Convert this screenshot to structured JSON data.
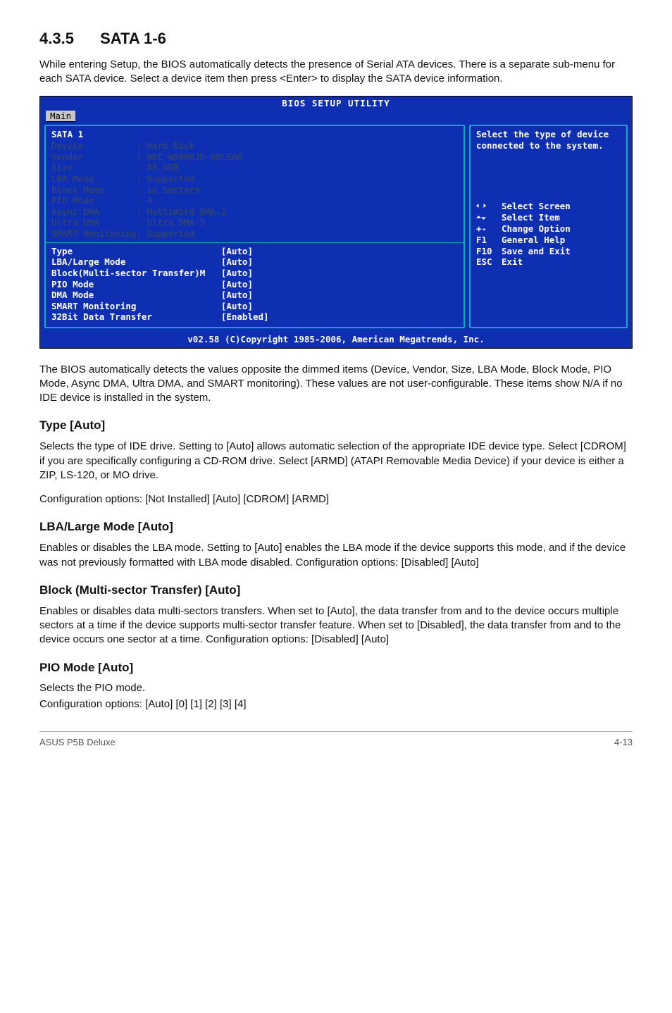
{
  "section": {
    "number": "4.3.5",
    "title": "SATA 1-6",
    "intro": "While entering Setup, the BIOS automatically detects the presence of Serial ATA devices. There is a separate sub-menu for each SATA device. Select a device item then press <Enter> to display the SATA device information."
  },
  "bios": {
    "header": "BIOS SETUP UTILITY",
    "tab": "Main",
    "panel_title": "SATA 1",
    "info": [
      {
        "label": "Device",
        "value": "Hard Disk"
      },
      {
        "label": "Vendor",
        "value": "WDC WD800JD-00LSA0"
      },
      {
        "label": "Size",
        "value": "80.0GB"
      },
      {
        "label": "LBA Mode",
        "value": "Supported"
      },
      {
        "label": "Block Mode",
        "value": "16 Sectors"
      },
      {
        "label": "PIO Mode",
        "value": "4"
      },
      {
        "label": "Async DMA",
        "value": "MultiWord DMA-2"
      },
      {
        "label": "Ultra DMA",
        "value": "Ultra DMA-5"
      },
      {
        "label": "SMART Monitoring",
        "value": "Supported"
      }
    ],
    "settings": [
      {
        "label": "Type",
        "value": "[Auto]"
      },
      {
        "label": "LBA/Large Mode",
        "value": "[Auto]"
      },
      {
        "label": "Block(Multi-sector Transfer)M",
        "value": "[Auto]"
      },
      {
        "label": "PIO Mode",
        "value": "[Auto]"
      },
      {
        "label": "DMA Mode",
        "value": "[Auto]"
      },
      {
        "label": "SMART Monitoring",
        "value": "[Auto]"
      },
      {
        "label": "32Bit Data Transfer",
        "value": "[Enabled]"
      }
    ],
    "help": "Select the type of device connected to the system.",
    "legend": [
      {
        "key": "←→",
        "desc": "Select Screen",
        "icon": "lr"
      },
      {
        "key": "↑↓",
        "desc": "Select Item",
        "icon": "ud"
      },
      {
        "key": "+-",
        "desc": "Change Option"
      },
      {
        "key": "F1",
        "desc": "General Help"
      },
      {
        "key": "F10",
        "desc": "Save and Exit"
      },
      {
        "key": "ESC",
        "desc": "Exit"
      }
    ],
    "footer": "v02.58 (C)Copyright 1985-2006, American Megatrends, Inc."
  },
  "post_bios_para": "The BIOS automatically detects the values opposite the dimmed items (Device, Vendor, Size, LBA Mode, Block Mode, PIO Mode, Async DMA, Ultra DMA, and SMART monitoring). These values are not user-configurable. These items show N/A if no IDE device is installed in the system.",
  "items": {
    "type": {
      "title": "Type [Auto]",
      "body": "Selects the type of IDE drive. Setting to [Auto] allows automatic selection of the appropriate IDE device type. Select [CDROM] if you are specifically configuring a CD-ROM drive. Select [ARMD] (ATAPI Removable Media Device) if your device is either a ZIP, LS-120, or MO drive.",
      "opts": "Configuration options: [Not Installed] [Auto] [CDROM] [ARMD]"
    },
    "lba": {
      "title": "LBA/Large Mode [Auto]",
      "body": "Enables or disables the LBA mode. Setting to [Auto] enables the LBA mode if the device supports this mode, and if the device was not previously formatted with LBA mode disabled. Configuration options: [Disabled] [Auto]"
    },
    "block": {
      "title": "Block (Multi-sector Transfer) [Auto]",
      "body": "Enables or disables data multi-sectors transfers. When set to [Auto], the data transfer from and to the device occurs multiple sectors at a time if the device supports multi-sector transfer feature. When set to [Disabled], the data transfer from and to the device occurs one sector at a time. Configuration options: [Disabled] [Auto]"
    },
    "pio": {
      "title": "PIO Mode [Auto]",
      "body": "Selects the PIO mode.",
      "opts": "Configuration options: [Auto] [0] [1] [2] [3] [4]"
    }
  },
  "footer": {
    "left": "ASUS P5B Deluxe",
    "right": "4-13"
  }
}
